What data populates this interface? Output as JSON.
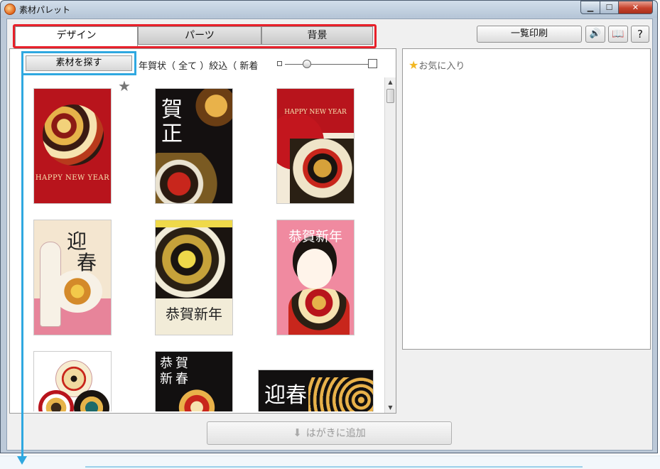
{
  "window": {
    "title": "素材パレット",
    "minimize": "▁",
    "maximize": "☐",
    "close": "✕"
  },
  "tabs": [
    {
      "label": "デザイン",
      "selected": true
    },
    {
      "label": "パーツ",
      "selected": false
    },
    {
      "label": "背景",
      "selected": false
    }
  ],
  "toolbar": {
    "print_label": "一覧印刷",
    "sound_icon": "🔊",
    "guide_icon": "📖",
    "help_label": "?"
  },
  "left": {
    "search_label": "素材を探す",
    "filter_text": "年賀状（ 全て ）絞込（ 新着",
    "star_glyph": "★"
  },
  "cards": [
    {
      "texts": [
        "HAPPY NEW YEAR"
      ]
    },
    {
      "texts": [
        "賀",
        "正"
      ]
    },
    {
      "texts": [
        "HAPPY NEW YEAR"
      ]
    },
    {
      "texts": [
        "迎",
        "春"
      ]
    },
    {
      "texts": [
        "恭賀新年"
      ]
    },
    {
      "texts": [
        "恭賀新年"
      ]
    },
    {
      "texts": []
    },
    {
      "texts": [
        "恭",
        "賀",
        "新",
        "春"
      ]
    },
    {
      "texts": [
        "迎春"
      ]
    }
  ],
  "right": {
    "favorites_label": "お気に入り",
    "favorites_star": "★"
  },
  "add_button": {
    "label": "はがきに追加",
    "arrow": "⬇"
  },
  "colors": {
    "tab_highlight": "#e8202a",
    "search_highlight": "#2fa8e0"
  }
}
